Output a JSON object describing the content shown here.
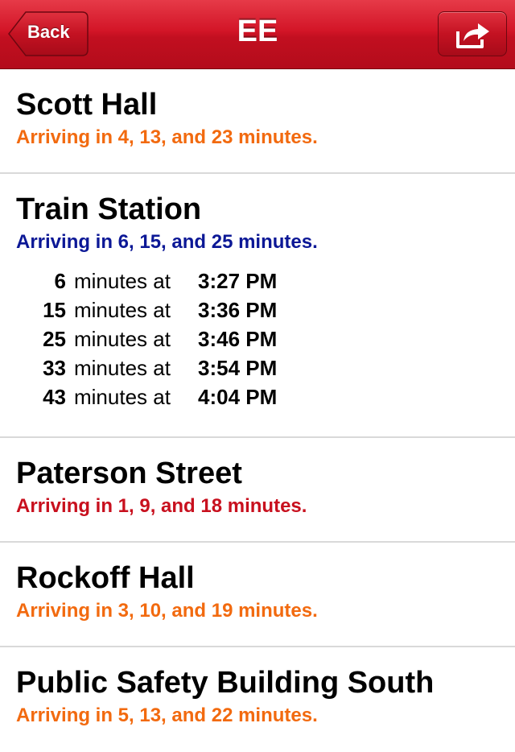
{
  "nav": {
    "back_label": "Back",
    "title": "EE",
    "share_icon": "share-arrow-icon"
  },
  "colors": {
    "orange": "#f26a0f",
    "blue": "#0c1896",
    "red": "#c8101e"
  },
  "stops": [
    {
      "name": "Scott Hall",
      "arrival_text": "Arriving in 4, 13, and 23 minutes.",
      "color": "orange"
    },
    {
      "name": "Train Station",
      "arrival_text": "Arriving in 6, 15, and 25 minutes.",
      "color": "blue",
      "schedule": [
        {
          "minutes": "6",
          "word": "minutes at",
          "time": "3:27 PM"
        },
        {
          "minutes": "15",
          "word": "minutes at",
          "time": "3:36 PM"
        },
        {
          "minutes": "25",
          "word": "minutes at",
          "time": "3:46 PM"
        },
        {
          "minutes": "33",
          "word": "minutes at",
          "time": "3:54 PM"
        },
        {
          "minutes": "43",
          "word": "minutes at",
          "time": "4:04 PM"
        }
      ]
    },
    {
      "name": "Paterson Street",
      "arrival_text": "Arriving in 1, 9, and 18 minutes.",
      "color": "red"
    },
    {
      "name": "Rockoff Hall",
      "arrival_text": "Arriving in 3, 10, and 19 minutes.",
      "color": "orange"
    },
    {
      "name": "Public Safety Building South",
      "arrival_text": "Arriving in 5, 13, and 22 minutes.",
      "color": "orange"
    }
  ]
}
